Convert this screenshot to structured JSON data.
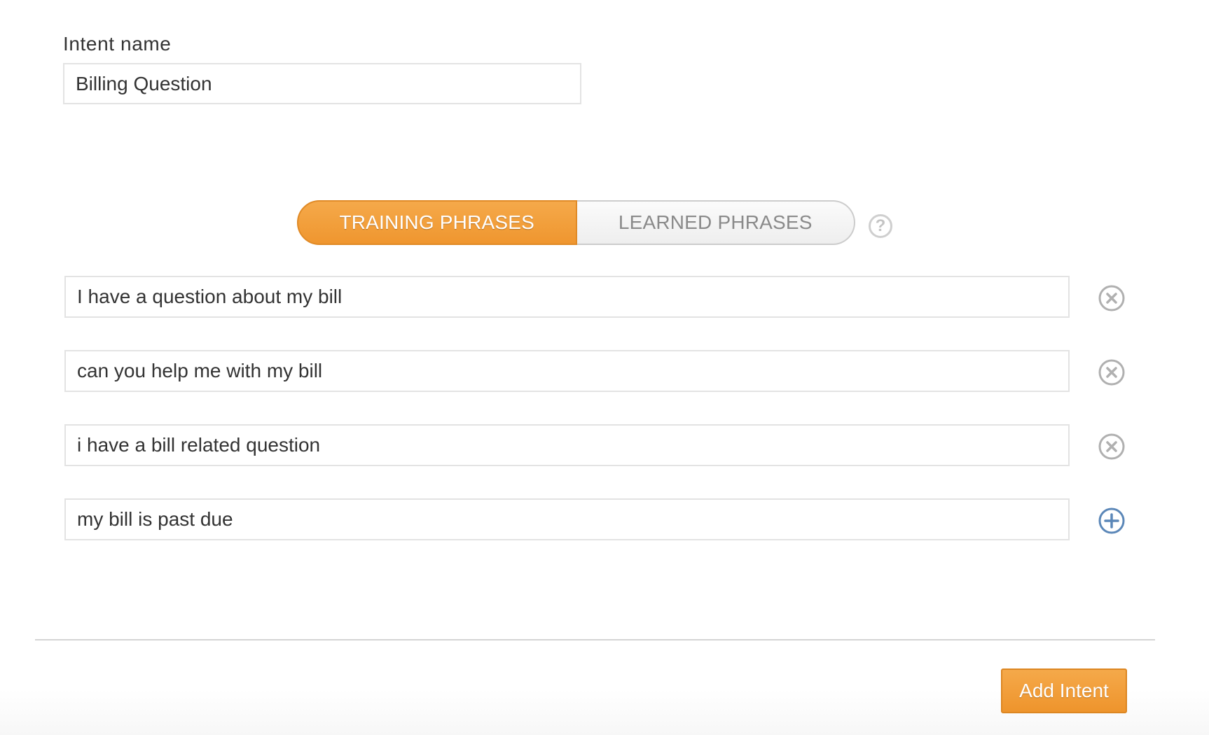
{
  "intent": {
    "label": "Intent name",
    "value": "Billing Question"
  },
  "tabs": {
    "training_label": "TRAINING PHRASES",
    "learned_label": "LEARNED PHRASES",
    "active": "training",
    "help_icon": "question-circle-icon",
    "help_glyph": "?"
  },
  "phrases": [
    {
      "value": "I have a question about my bill",
      "action_icon": "remove-circle-icon"
    },
    {
      "value": "can you help me with my bill",
      "action_icon": "remove-circle-icon"
    },
    {
      "value": "i have a bill related question",
      "action_icon": "remove-circle-icon"
    },
    {
      "value": "my bill is past due",
      "action_icon": "add-circle-icon"
    }
  ],
  "footer": {
    "add_intent_label": "Add Intent"
  },
  "colors": {
    "accent_orange": "#f19c35",
    "remove_icon_gray": "#b0b0b0",
    "add_icon_blue": "#5b87b8",
    "input_border": "#e3e3e3"
  }
}
